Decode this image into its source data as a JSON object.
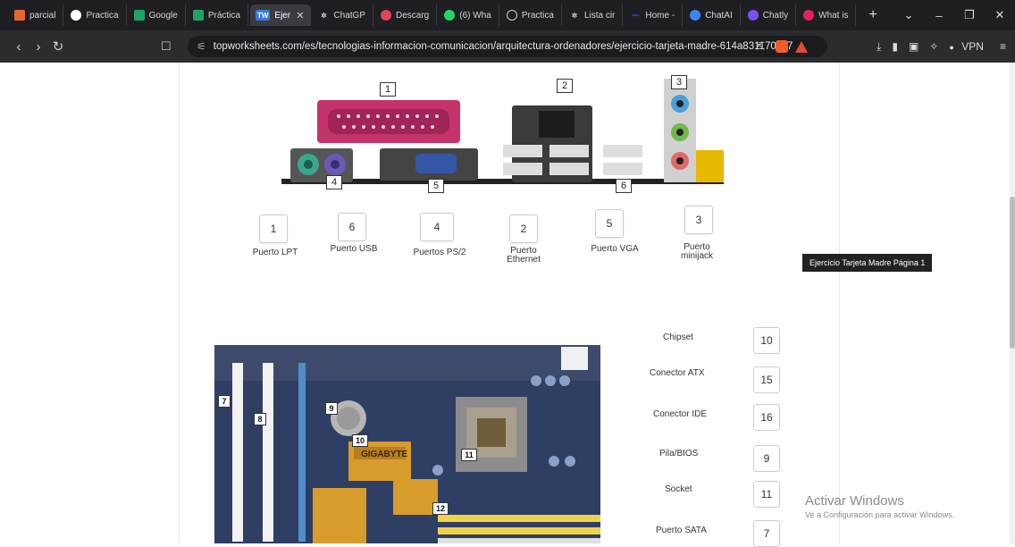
{
  "browser": {
    "tabs": [
      {
        "label": "parcial",
        "color": "#e8692f"
      },
      {
        "label": "Practica",
        "color": "#ffffff"
      },
      {
        "label": "Google",
        "color": "#1fa463"
      },
      {
        "label": "Práctica",
        "color": "#1fa463"
      },
      {
        "label": "Ejer",
        "color": "#3a7bd5",
        "active": true,
        "badge": "TW"
      },
      {
        "label": "ChatGP",
        "color": "#cccccc"
      },
      {
        "label": "Descarg",
        "color": "#e2425b"
      },
      {
        "label": "(6) Wha",
        "color": "#25d366"
      },
      {
        "label": "Practica",
        "color": "#cccccc"
      },
      {
        "label": "Lista cir",
        "color": "#cccccc"
      },
      {
        "label": "Home -",
        "color": "#3d5afe"
      },
      {
        "label": "ChatAI",
        "color": "#4285f4"
      },
      {
        "label": "Chatly",
        "color": "#7c4dff"
      },
      {
        "label": "What is",
        "color": "#e91e63"
      }
    ],
    "url": "topworksheets.com/es/tecnologias-informacion-comunicacion/arquitectura-ordenadores/ejercicio-tarjeta-madre-614a831170c87",
    "vpn_label": "VPN"
  },
  "io_panel": {
    "callouts": [
      "1",
      "2",
      "3",
      "4",
      "5",
      "6"
    ],
    "answers": [
      {
        "value": "1",
        "label": "Puerto LPT"
      },
      {
        "value": "6",
        "label": "Puerto USB"
      },
      {
        "value": "4",
        "label": "Puertos PS/2"
      },
      {
        "value": "2",
        "label": "Puerto Ethernet"
      },
      {
        "value": "5",
        "label": "Puerto VGA"
      },
      {
        "value": "3",
        "label": "Puerto minijack"
      }
    ]
  },
  "tooltip": "Ejercicio Tarjeta Madre Página 1",
  "motherboard": {
    "callouts": [
      "7",
      "8",
      "9",
      "10",
      "11",
      "12"
    ],
    "brand": "GIGABYTE",
    "answers": [
      {
        "label": "Chipset",
        "value": "10"
      },
      {
        "label": "Conector ATX",
        "value": "15"
      },
      {
        "label": "Conector IDE",
        "value": "16"
      },
      {
        "label": "Pila/BIOS",
        "value": "9"
      },
      {
        "label": "Socket",
        "value": "11"
      },
      {
        "label": "Puerto SATA",
        "value": "7"
      }
    ]
  },
  "windows_notice": {
    "title": "Activar Windows",
    "subtitle": "Ve a Configuración para activar Windows."
  }
}
